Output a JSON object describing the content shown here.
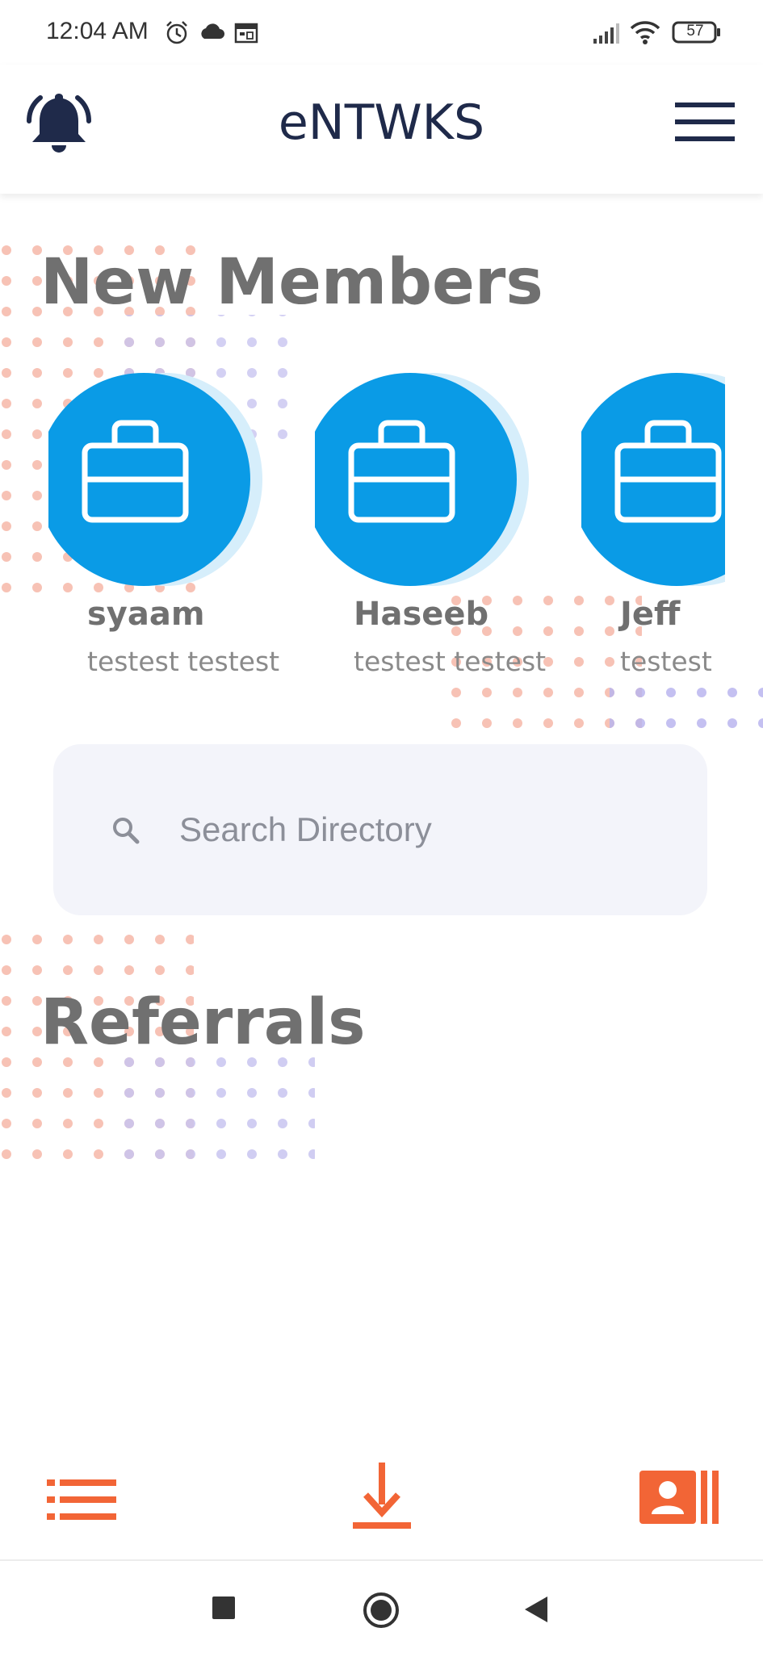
{
  "status_bar": {
    "time": "12:04 AM",
    "icons": [
      "alarm-icon",
      "cloud-icon",
      "calendar-icon"
    ],
    "right_icons": [
      "cellular-signal-icon",
      "wifi-icon",
      "battery-icon"
    ],
    "battery_level": "57"
  },
  "header": {
    "title": "eNTWKS",
    "left_icon": "bell-icon",
    "right_icon": "hamburger-menu-icon"
  },
  "new_members": {
    "title": "New Members",
    "members": [
      {
        "name": "syaam",
        "subtitle": "testest testest",
        "avatar_icon": "briefcase-icon"
      },
      {
        "name": "Haseeb",
        "subtitle": "testest testest",
        "avatar_icon": "briefcase-icon"
      },
      {
        "name": "Jeff",
        "subtitle": "testest",
        "avatar_icon": "briefcase-icon"
      }
    ]
  },
  "search": {
    "placeholder": "Search Directory",
    "value": ""
  },
  "referrals": {
    "title": "Referrals"
  },
  "bottom_nav": {
    "items": [
      "list-icon",
      "download-icon",
      "contact-card-icon"
    ]
  },
  "system_nav": {
    "items": [
      "recents-square-icon",
      "home-circle-icon",
      "back-triangle-icon"
    ]
  },
  "colors": {
    "accent": "#f26536",
    "avatar_blue": "#0a9be6",
    "avatar_light": "#d6eefb",
    "title_navy": "#1f2a4a",
    "heading_gray": "#707070",
    "search_bg": "#f3f4fa"
  }
}
